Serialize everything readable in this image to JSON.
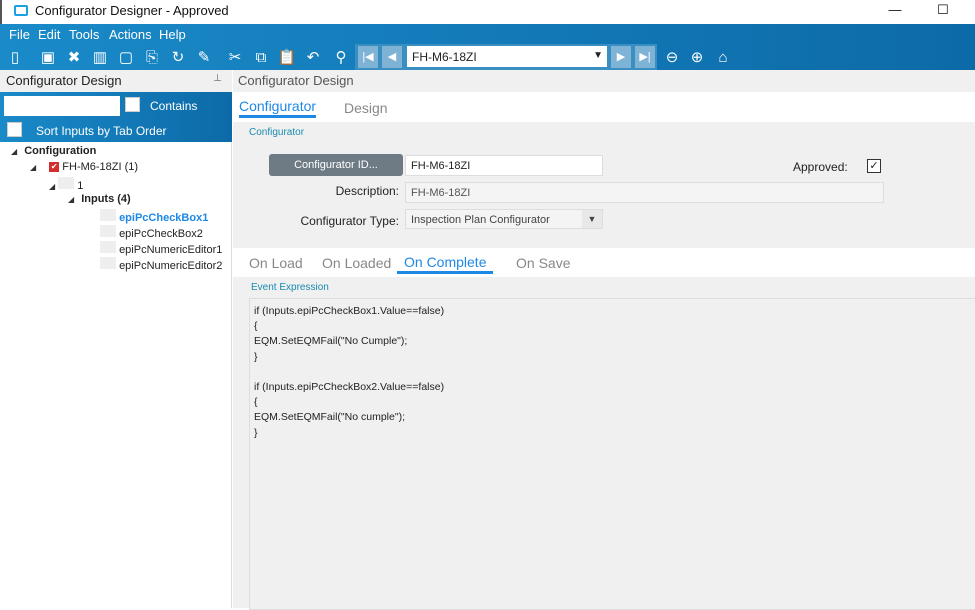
{
  "window": {
    "title": "Configurator Designer - Approved",
    "minimize": "—",
    "maximize": "☐"
  },
  "menu": [
    "File",
    "Edit",
    "Tools",
    "Actions",
    "Help"
  ],
  "toolbar": {
    "record_value": "FH-M6-18ZI"
  },
  "left_panel": {
    "title": "Configurator Design",
    "pin": "⊥",
    "contains_label": "Contains",
    "sort_label": "Sort Inputs by Tab Order",
    "tree": {
      "root": "Configuration",
      "config": "FH-M6-18ZI (1)",
      "page": "1",
      "inputs": "Inputs (4)",
      "items": [
        "epiPcCheckBox1",
        "epiPcCheckBox2",
        "epiPcNumericEditor1",
        "epiPcNumericEditor2"
      ]
    }
  },
  "main": {
    "header": "Configurator Design",
    "tabs": [
      "Configurator",
      "Design"
    ],
    "group_label": "Configurator",
    "config_id_button": "Configurator ID...",
    "config_id": "FH-M6-18ZI",
    "approved_label": "Approved:",
    "approved": true,
    "description_label": "Description:",
    "description": "FH-M6-18ZI",
    "type_label": "Configurator Type:",
    "type": "Inspection Plan Configurator",
    "event_tabs": [
      "On Load",
      "On Loaded",
      "On Complete",
      "On Save"
    ],
    "event_label": "Event Expression",
    "code": "if (Inputs.epiPcCheckBox1.Value==false)\n{\nEQM.SetEQMFail(\"No Cumple\");\n}\n\nif (Inputs.epiPcCheckBox2.Value==false)\n{\nEQM.SetEQMFail(\"No cumple\");\n}"
  },
  "colors": {
    "accent": "#1e88e5",
    "band": "#1a8ac8"
  }
}
